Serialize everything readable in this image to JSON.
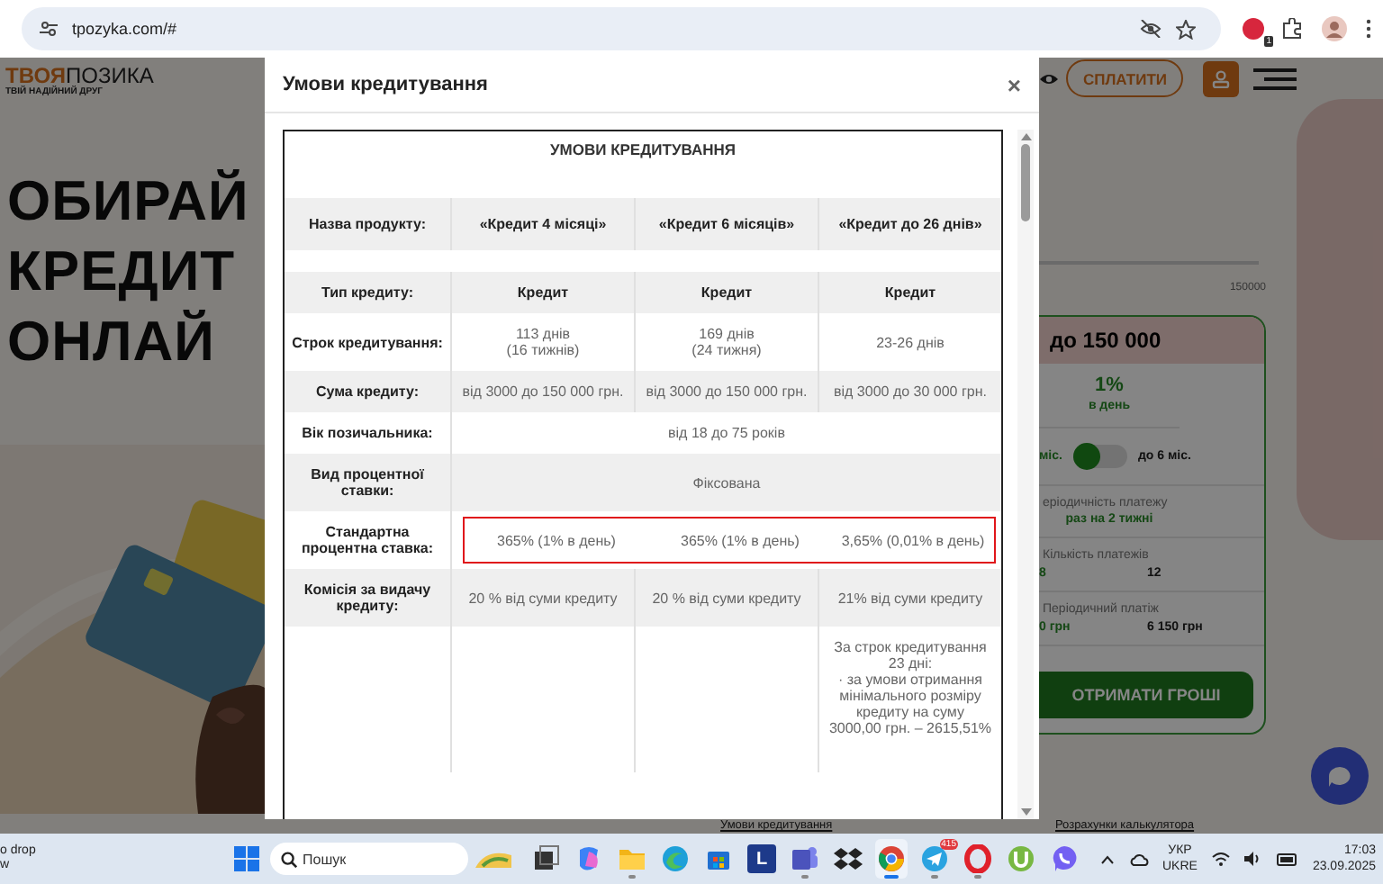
{
  "browser": {
    "url": "tpozyka.com/#",
    "extension_badge": "1"
  },
  "site": {
    "logo": {
      "accent": "ТВОЯ",
      "name": "ПОЗИКА",
      "tagline": "ТВІЙ НАДІЙНИЙ ДРУГ"
    },
    "pay_button": "СПЛАТИТИ",
    "hero_lines": [
      "ОБИРАЙ",
      "КРЕДИТ",
      "ОНЛАЙ"
    ],
    "calculator": {
      "max_amount": "150000",
      "heading": "до 150 000",
      "rate": "1%",
      "rate_unit": "в день",
      "term_short": "міс.",
      "term_long": "до 6 міс.",
      "long_term_on": false,
      "stats": [
        {
          "kind": "single",
          "label": "еріодичність платежу",
          "values": [
            "раз на 2 тижні"
          ]
        },
        {
          "kind": "pair",
          "label": "Кількість платежів",
          "values": [
            "8",
            "12"
          ]
        },
        {
          "kind": "pair",
          "label": "Періодичний платіж",
          "values": [
            "0 грн",
            "6 150 грн"
          ]
        }
      ],
      "cta": "ОТРИМАТИ ГРОШІ"
    },
    "footer_links": [
      "Умови кредитування",
      "Розрахунки калькулятора"
    ]
  },
  "modal": {
    "title": "Умови кредитування",
    "close": "×",
    "table": {
      "title": "УМОВИ КРЕДИТУВАННЯ",
      "products": {
        "label": "Назва продукту:",
        "cells": [
          "«Кредит 4 місяці»",
          "«Кредит 6 місяців»",
          "«Кредит до 26 днів»"
        ]
      },
      "rows": [
        {
          "label": "Тип кредиту:",
          "bold": true,
          "highlighted": false,
          "cells": [
            "Кредит",
            "Кредит",
            "Кредит"
          ]
        },
        {
          "label": "Строк кредитування:",
          "bold": false,
          "highlighted": false,
          "cells": [
            "113 днів\n(16 тижнів)\n ",
            "169 днів\n(24 тижня)\n ",
            "23-26 днів"
          ]
        },
        {
          "label": "Сума кредиту:",
          "bold": false,
          "highlighted": false,
          "cells": [
            "від 3000 до 150 000 грн.",
            "від 3000 до 150 000 грн.",
            "від 3000 до 30 000 грн."
          ]
        },
        {
          "label": "Вік позичальника:",
          "bold": false,
          "highlighted": false,
          "cells": [
            "від 18 до 75 років"
          ]
        },
        {
          "label": "Вид процентної ставки:",
          "bold": false,
          "highlighted": false,
          "cells": [
            "Фіксована"
          ]
        },
        {
          "label": "Стандартна процентна ставка:",
          "bold": false,
          "highlighted": true,
          "cells": [
            "365% (1% в день)",
            "365% (1% в день)",
            "3,65% (0,01% в день)"
          ]
        },
        {
          "label": "Комісія за видачу кредиту:",
          "bold": false,
          "highlighted": false,
          "cells": [
            "20 % від суми кредиту",
            "20 % від суми кредиту",
            "21% від суми кредиту"
          ]
        },
        {
          "bold": false,
          "highlighted": false,
          "cells": [
            null,
            null,
            "За строк кредитування 23 дні:\n· за умови отримання мінімального розміру   кредиту на суму 3000,00 грн. – 2615,51%"
          ]
        }
      ]
    }
  },
  "taskbar": {
    "notification": [
      "o drop",
      "w"
    ],
    "search": {
      "placeholder": "Пошук"
    },
    "apps": [
      {
        "kind": "task-view",
        "running": false,
        "selected": false
      },
      {
        "kind": "copilot",
        "running": false,
        "selected": false
      },
      {
        "kind": "folder",
        "running": true,
        "selected": false
      },
      {
        "kind": "edge",
        "running": false,
        "selected": false
      },
      {
        "kind": "store",
        "running": false,
        "selected": false
      },
      {
        "kind": "letter",
        "label": "L",
        "running": false,
        "selected": false
      },
      {
        "kind": "teams",
        "running": true,
        "selected": false
      },
      {
        "kind": "dropbox",
        "running": false,
        "selected": false
      },
      {
        "kind": "chrome",
        "running": true,
        "selected": true
      },
      {
        "kind": "telegram",
        "badge": "415",
        "running": true,
        "selected": false
      },
      {
        "kind": "opera",
        "running": true,
        "selected": false
      },
      {
        "kind": "utorrent",
        "running": false,
        "selected": false
      },
      {
        "kind": "viber",
        "running": false,
        "selected": false
      }
    ],
    "language": [
      "УКР",
      "UKRE"
    ],
    "time": "17:03",
    "date": "23.09.2025"
  }
}
